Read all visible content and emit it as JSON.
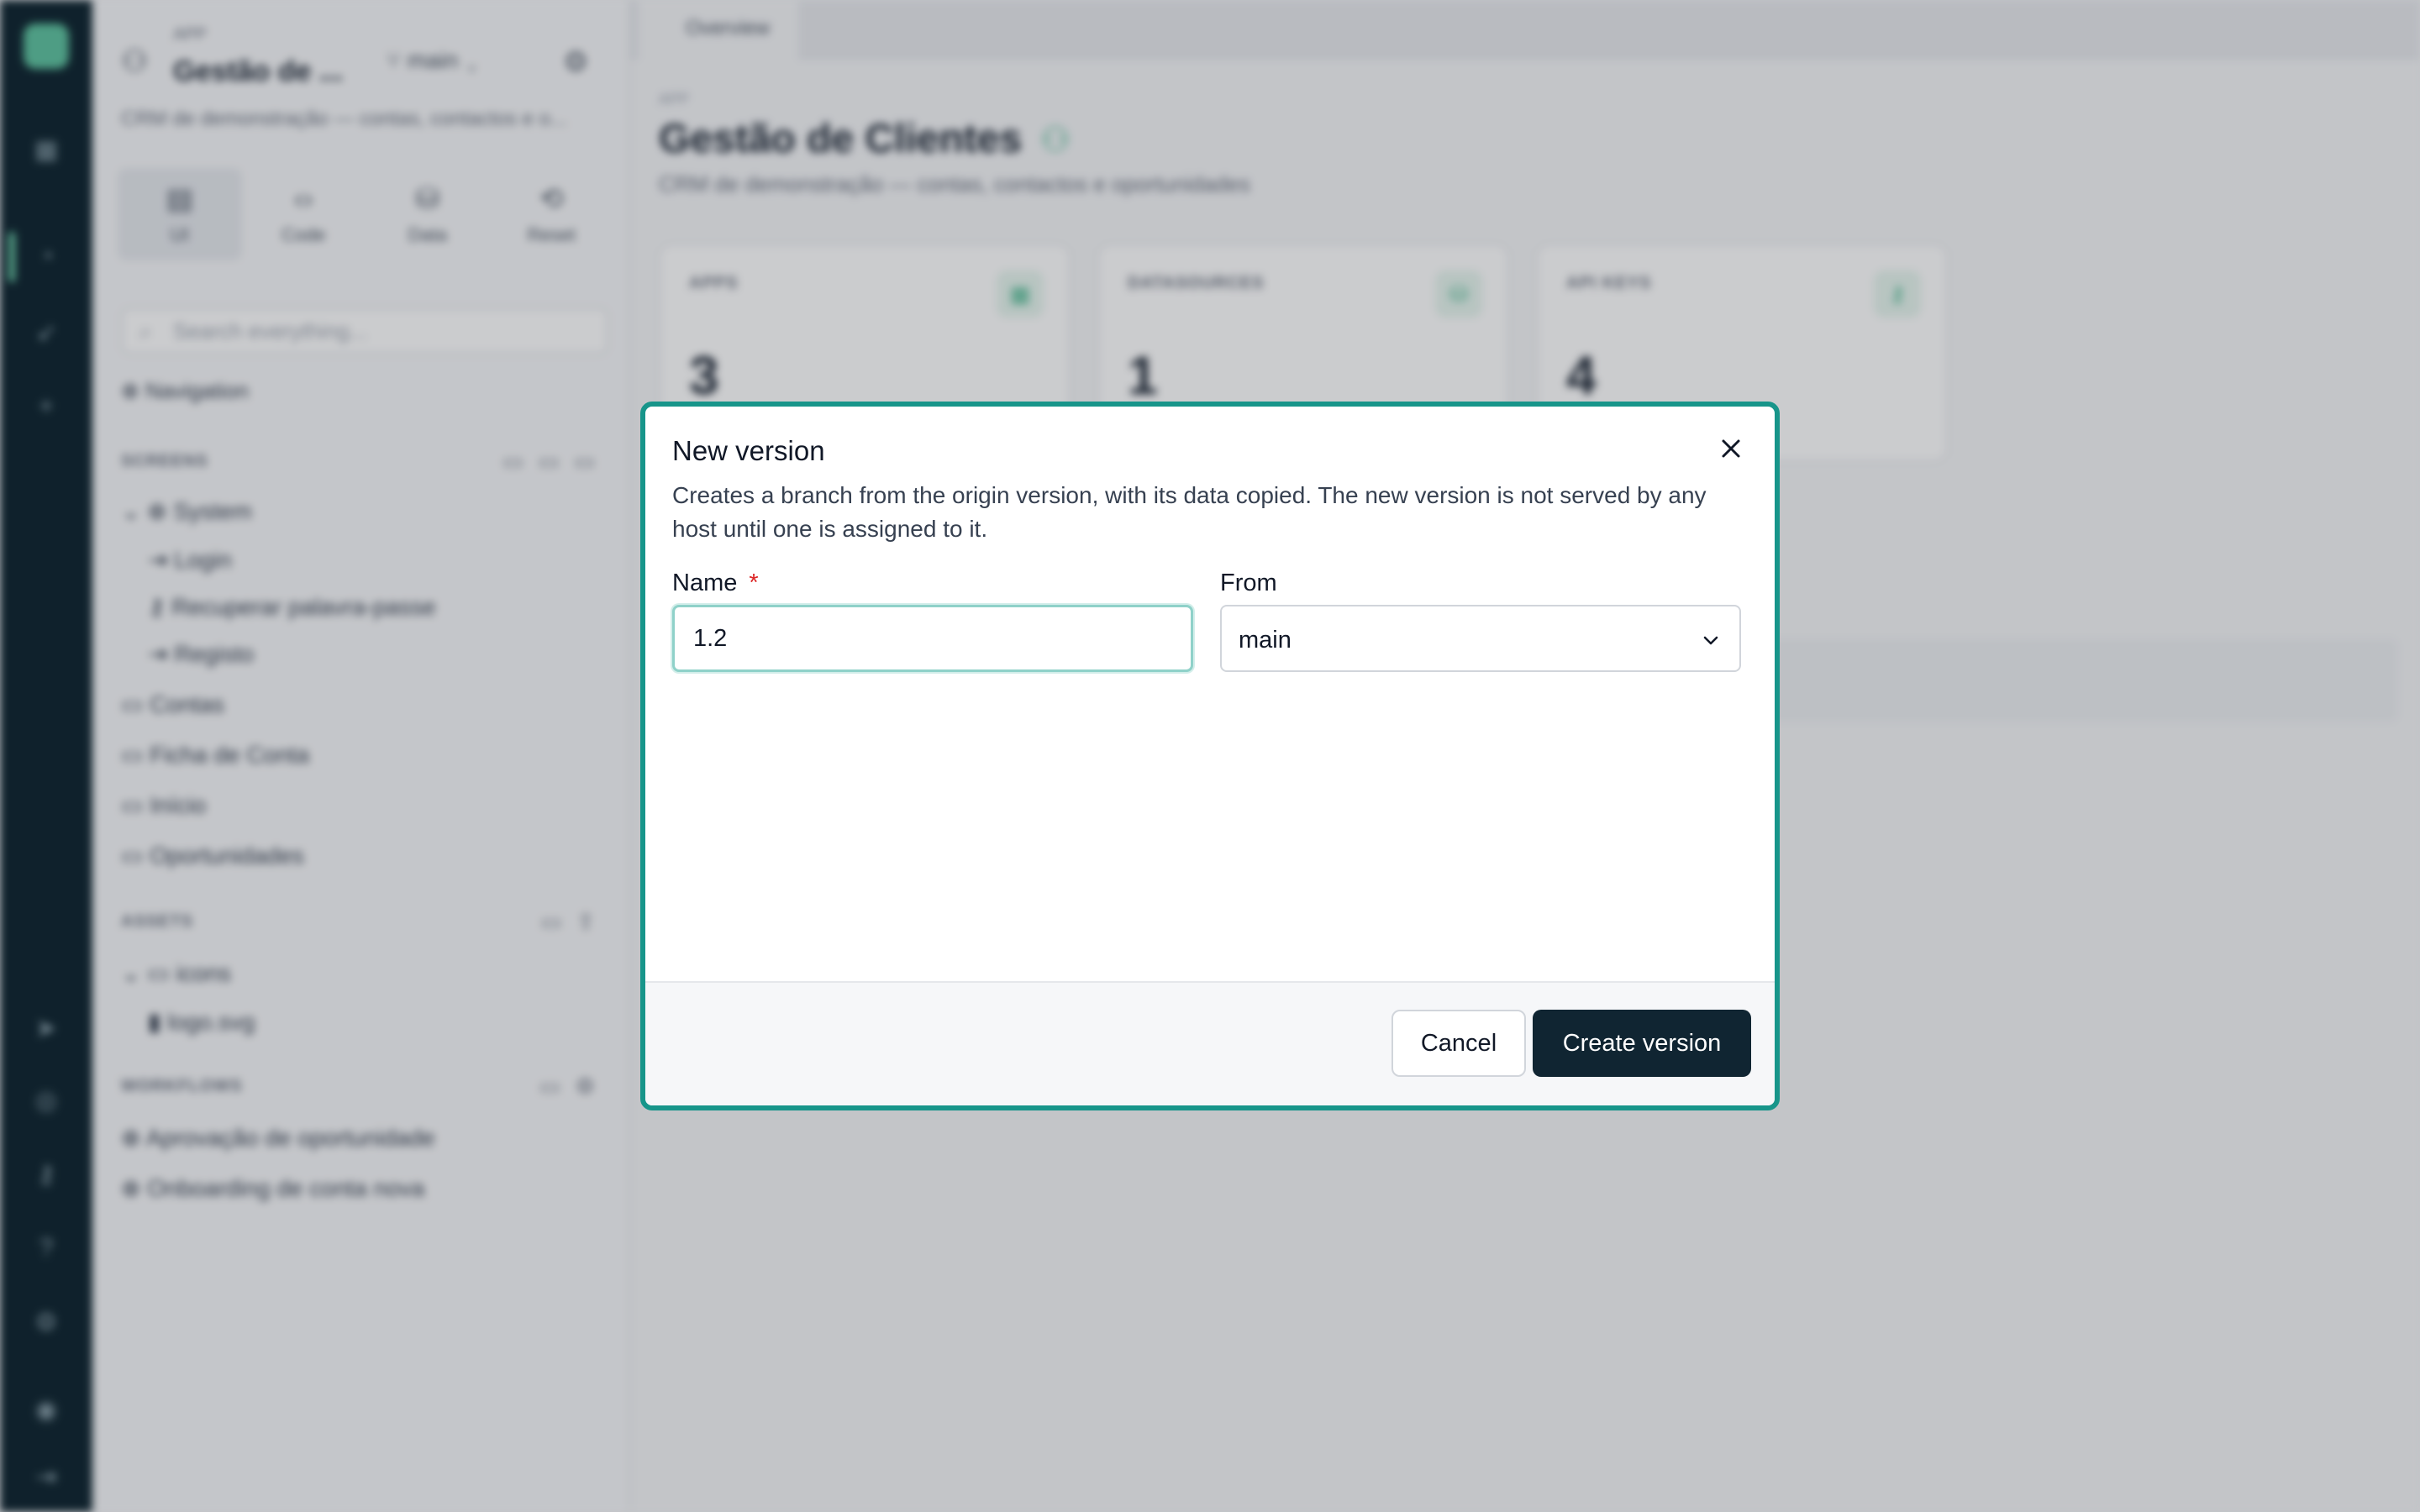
{
  "background": {
    "sidebar": {
      "app_kicker": "APP",
      "app_title": "Gestão de ...",
      "branch": "main",
      "description": "CRM de demonstração — contas, contactos e o...",
      "tabs": [
        {
          "label": "UI",
          "icon": "layout-icon"
        },
        {
          "label": "Code",
          "icon": "code-icon"
        },
        {
          "label": "Data",
          "icon": "database-icon"
        },
        {
          "label": "Reset",
          "icon": "reset-icon"
        }
      ],
      "search_placeholder": "Search everything...",
      "navigation_label": "Navigation",
      "screens_header": "SCREENS",
      "screens": {
        "system_group": "System",
        "system_children": [
          "Login",
          "Recuperar palavra-passe",
          "Registo"
        ],
        "items": [
          "Contas",
          "Ficha de Conta",
          "Início",
          "Oportunidades"
        ]
      },
      "assets_header": "ASSETS",
      "assets": {
        "folder": "icons",
        "file": "logo.svg"
      },
      "workflows_header": "WORKFLOWS",
      "workflows": [
        "Aprovação de oportunidade",
        "Onboarding de conta nova"
      ]
    },
    "main": {
      "tab_label": "Overview",
      "kicker": "APP",
      "title": "Gestão de Clientes",
      "description": "CRM de demonstração — contas, contactos e oportunidades",
      "stats": [
        {
          "label": "APPS",
          "value": "3"
        },
        {
          "label": "DATASOURCES",
          "value": "1"
        },
        {
          "label": "API KEYS",
          "value": "4"
        }
      ]
    }
  },
  "modal": {
    "title": "New version",
    "description": "Creates a branch from the origin version, with its data copied. The new version is not served by any host until one is assigned to it.",
    "name_label": "Name",
    "required_marker": "*",
    "name_value": "1.2",
    "from_label": "From",
    "from_value": "main",
    "cancel_label": "Cancel",
    "create_label": "Create version",
    "accent_color": "#17958a",
    "primary_button_color": "#102532"
  }
}
